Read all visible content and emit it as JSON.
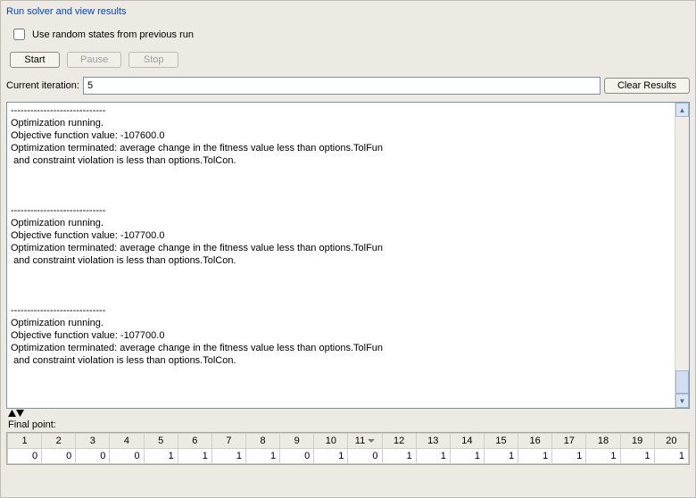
{
  "section_title": "Run solver and view results",
  "use_previous_label": "Use random states from previous run",
  "use_previous_checked": false,
  "buttons": {
    "start": "Start",
    "pause": "Pause",
    "stop": "Stop",
    "clear": "Clear Results"
  },
  "iteration_label": "Current iteration:",
  "iteration_value": "5",
  "output_text": "-----------------------------\nOptimization running.\nObjective function value: -107600.0\nOptimization terminated: average change in the fitness value less than options.TolFun\n and constraint violation is less than options.TolCon.\n\n\n\n-----------------------------\nOptimization running.\nObjective function value: -107700.0\nOptimization terminated: average change in the fitness value less than options.TolFun\n and constraint violation is less than options.TolCon.\n\n\n\n-----------------------------\nOptimization running.\nObjective function value: -107700.0\nOptimization terminated: average change in the fitness value less than options.TolFun\n and constraint violation is less than options.TolCon.",
  "final_point_label": "Final point:",
  "final_point": {
    "headers": [
      "1",
      "2",
      "3",
      "4",
      "5",
      "6",
      "7",
      "8",
      "9",
      "10",
      "11",
      "12",
      "13",
      "14",
      "15",
      "16",
      "17",
      "18",
      "19",
      "20"
    ],
    "sort_col_index": 10,
    "values": [
      "0",
      "0",
      "0",
      "0",
      "1",
      "1",
      "1",
      "1",
      "0",
      "1",
      "0",
      "1",
      "1",
      "1",
      "1",
      "1",
      "1",
      "1",
      "1",
      "1"
    ]
  },
  "icons": {
    "scroll_up": "▲",
    "scroll_down": "▼"
  }
}
